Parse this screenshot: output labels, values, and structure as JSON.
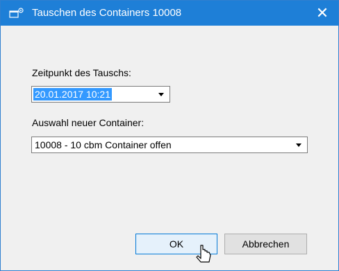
{
  "window": {
    "title": "Tauschen des Containers 10008",
    "close_glyph": "✕",
    "titlebar_color": "#1e7fd7"
  },
  "form": {
    "time_label": "Zeitpunkt des Tauschs:",
    "time_value": "20.01.2017 10:21",
    "container_label": "Auswahl neuer Container:",
    "container_value": "10008 - 10 cbm Container offen"
  },
  "buttons": {
    "ok_label": "OK",
    "cancel_label": "Abbrechen"
  },
  "icons": {
    "window": "app-window-icon",
    "close": "close-icon",
    "dropdown": "chevron-down-icon",
    "cursor": "mouse-pointer-icon"
  }
}
